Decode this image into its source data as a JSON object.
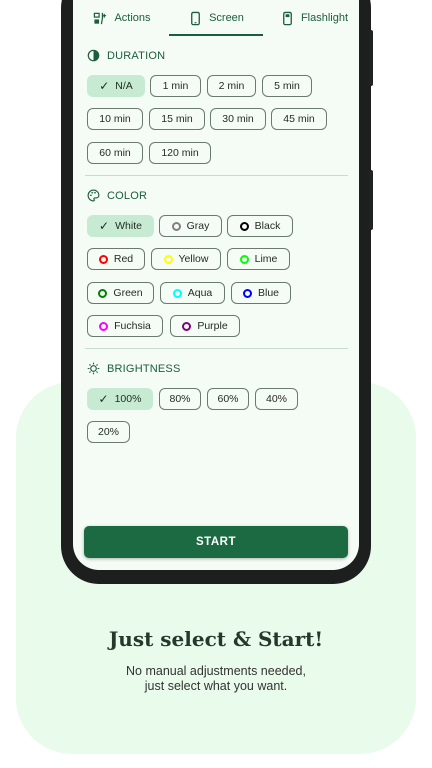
{
  "tabs": [
    {
      "label": "Actions",
      "icon": "actions-icon"
    },
    {
      "label": "Screen",
      "icon": "phone-icon",
      "active": true
    },
    {
      "label": "Flashlight",
      "icon": "flashlight-icon"
    }
  ],
  "duration": {
    "heading": "DURATION",
    "options": [
      "N/A",
      "1 min",
      "2 min",
      "5 min",
      "10 min",
      "15 min",
      "30 min",
      "45 min",
      "60 min",
      "120 min"
    ],
    "selected": "N/A"
  },
  "color": {
    "heading": "COLOR",
    "options": [
      {
        "label": "White",
        "color": "#ffffff"
      },
      {
        "label": "Gray",
        "color": "#808080"
      },
      {
        "label": "Black",
        "color": "#000000"
      },
      {
        "label": "Red",
        "color": "#ff0000"
      },
      {
        "label": "Yellow",
        "color": "#ffff00"
      },
      {
        "label": "Lime",
        "color": "#00ff00"
      },
      {
        "label": "Green",
        "color": "#008000"
      },
      {
        "label": "Aqua",
        "color": "#00ffff"
      },
      {
        "label": "Blue",
        "color": "#0000ff"
      },
      {
        "label": "Fuchsia",
        "color": "#ff00ff"
      },
      {
        "label": "Purple",
        "color": "#800080"
      }
    ],
    "selected": "White"
  },
  "brightness": {
    "heading": "BRIGHTNESS",
    "options": [
      "100%",
      "80%",
      "60%",
      "40%",
      "20%"
    ],
    "selected": "100%"
  },
  "start_label": "START",
  "promo": {
    "title": "Just select & Start!",
    "line1": "No manual adjustments needed,",
    "line2": "just select what you want."
  },
  "colors": {
    "accent": "#1b6a42",
    "selected_chip": "#c6ebd2",
    "card_bg": "#e9fbea"
  }
}
